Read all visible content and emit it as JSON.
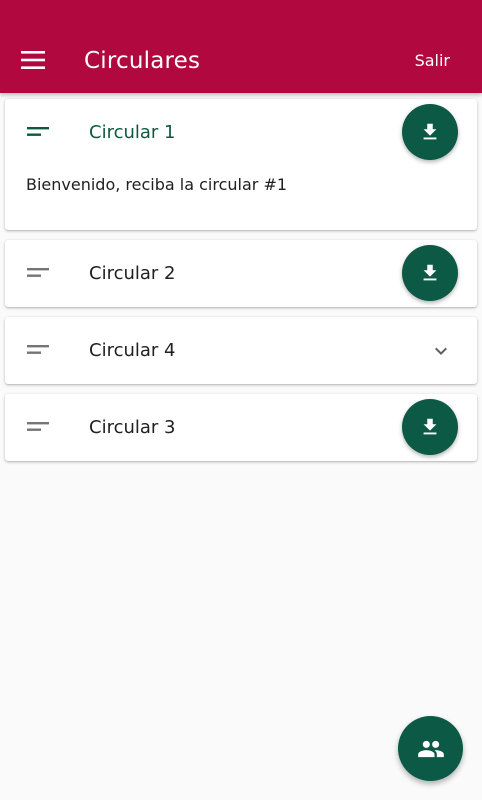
{
  "appbar": {
    "title": "Circulares",
    "logout_label": "Salir",
    "menu_icon": "menu-icon",
    "color": "#b0083f"
  },
  "circulars": [
    {
      "title": "Circular 1",
      "expanded": true,
      "body": "Bienvenido, reciba la circular #1",
      "action_icon": "download-icon"
    },
    {
      "title": "Circular 2",
      "expanded": false,
      "action_icon": "download-icon"
    },
    {
      "title": "Circular 4",
      "expanded": false,
      "action_icon": "chevron-down-icon"
    },
    {
      "title": "Circular 3",
      "expanded": false,
      "action_icon": "download-icon"
    }
  ],
  "fab": {
    "icon": "people-icon"
  },
  "colors": {
    "accent_green": "#0c5a45",
    "title_green": "#0c5a3e",
    "background": "#fafafa"
  }
}
